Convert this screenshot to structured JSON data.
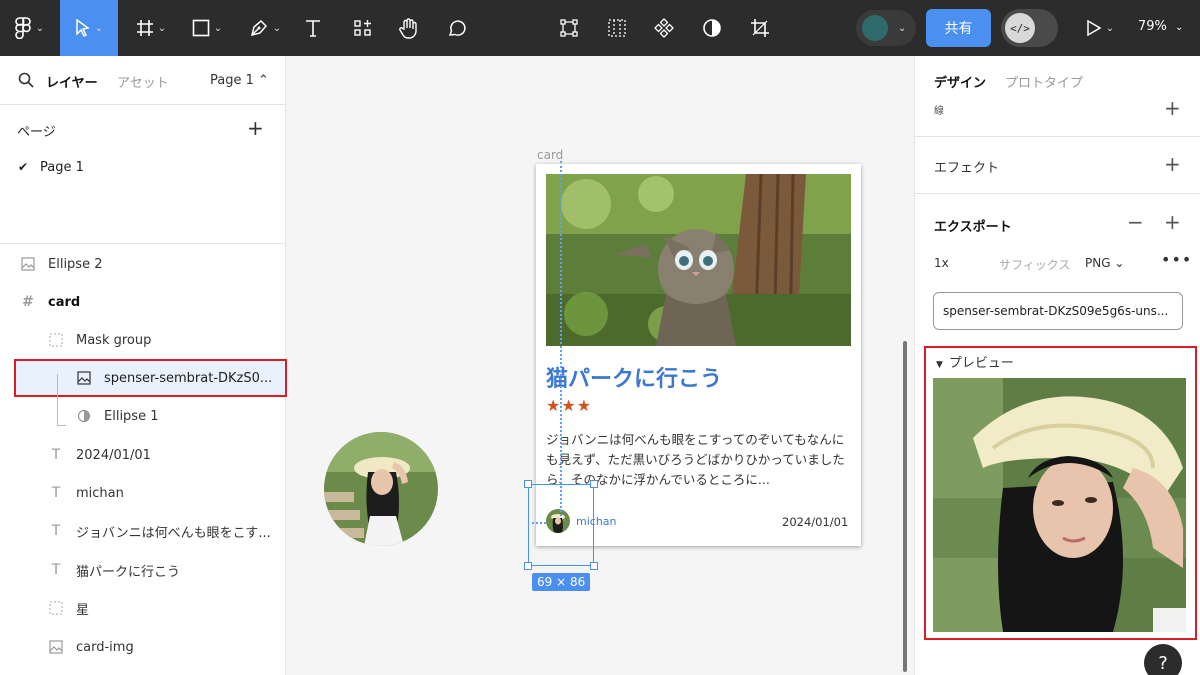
{
  "toolbar": {
    "share_label": "共有",
    "dev_mode_label": "</>",
    "zoom": "79%",
    "avatar_color": "#2f6b6b",
    "accent": "#4b8ff0"
  },
  "left_panel": {
    "tab_layers": "レイヤー",
    "tab_assets": "アセット",
    "page_selector": "Page 1 ⌃",
    "pages_heading": "ページ",
    "pages": [
      "Page 1"
    ],
    "layers": [
      {
        "label": "Ellipse 2",
        "icon": "image-icon"
      },
      {
        "label": "card",
        "icon": "frame-icon"
      },
      {
        "label": "Mask group",
        "icon": "group-icon"
      },
      {
        "label": "spenser-sembrat-DKzS0...",
        "icon": "image-icon",
        "selected": true
      },
      {
        "label": "Ellipse 1",
        "icon": "ellipse-icon"
      },
      {
        "label": "2024/01/01",
        "icon": "text-icon"
      },
      {
        "label": "michan",
        "icon": "text-icon"
      },
      {
        "label": "ジョバンニは何べんも眼をこす...",
        "icon": "text-icon"
      },
      {
        "label": "猫パークに行こう",
        "icon": "text-icon"
      },
      {
        "label": "星",
        "icon": "group-icon"
      },
      {
        "label": "card-img",
        "icon": "image-icon"
      }
    ]
  },
  "canvas": {
    "frame_label": "card",
    "card_title": "猫パークに行こう",
    "card_stars": "★★★",
    "card_body": "ジョバンニは何べんも眼をこすってのぞいてもなんにも見えず、ただ黒いびろうどばかりひかっていましたら、そのなかに浮かんでいるところに...",
    "card_author": "michan",
    "card_date": "2024/01/01",
    "selection_size": "69 × 86"
  },
  "right_panel": {
    "tab_design": "デザイン",
    "tab_prototype": "プロトタイプ",
    "stroke_label": "線",
    "effects_heading": "エフェクト",
    "export_heading": "エクスポート",
    "export_scale": "1x",
    "export_suffix_placeholder": "サフィックス",
    "export_format": "PNG ⌄",
    "export_filename": "spenser-sembrat-DKzS09e5g6s-uns...",
    "preview_heading": "プレビュー"
  }
}
